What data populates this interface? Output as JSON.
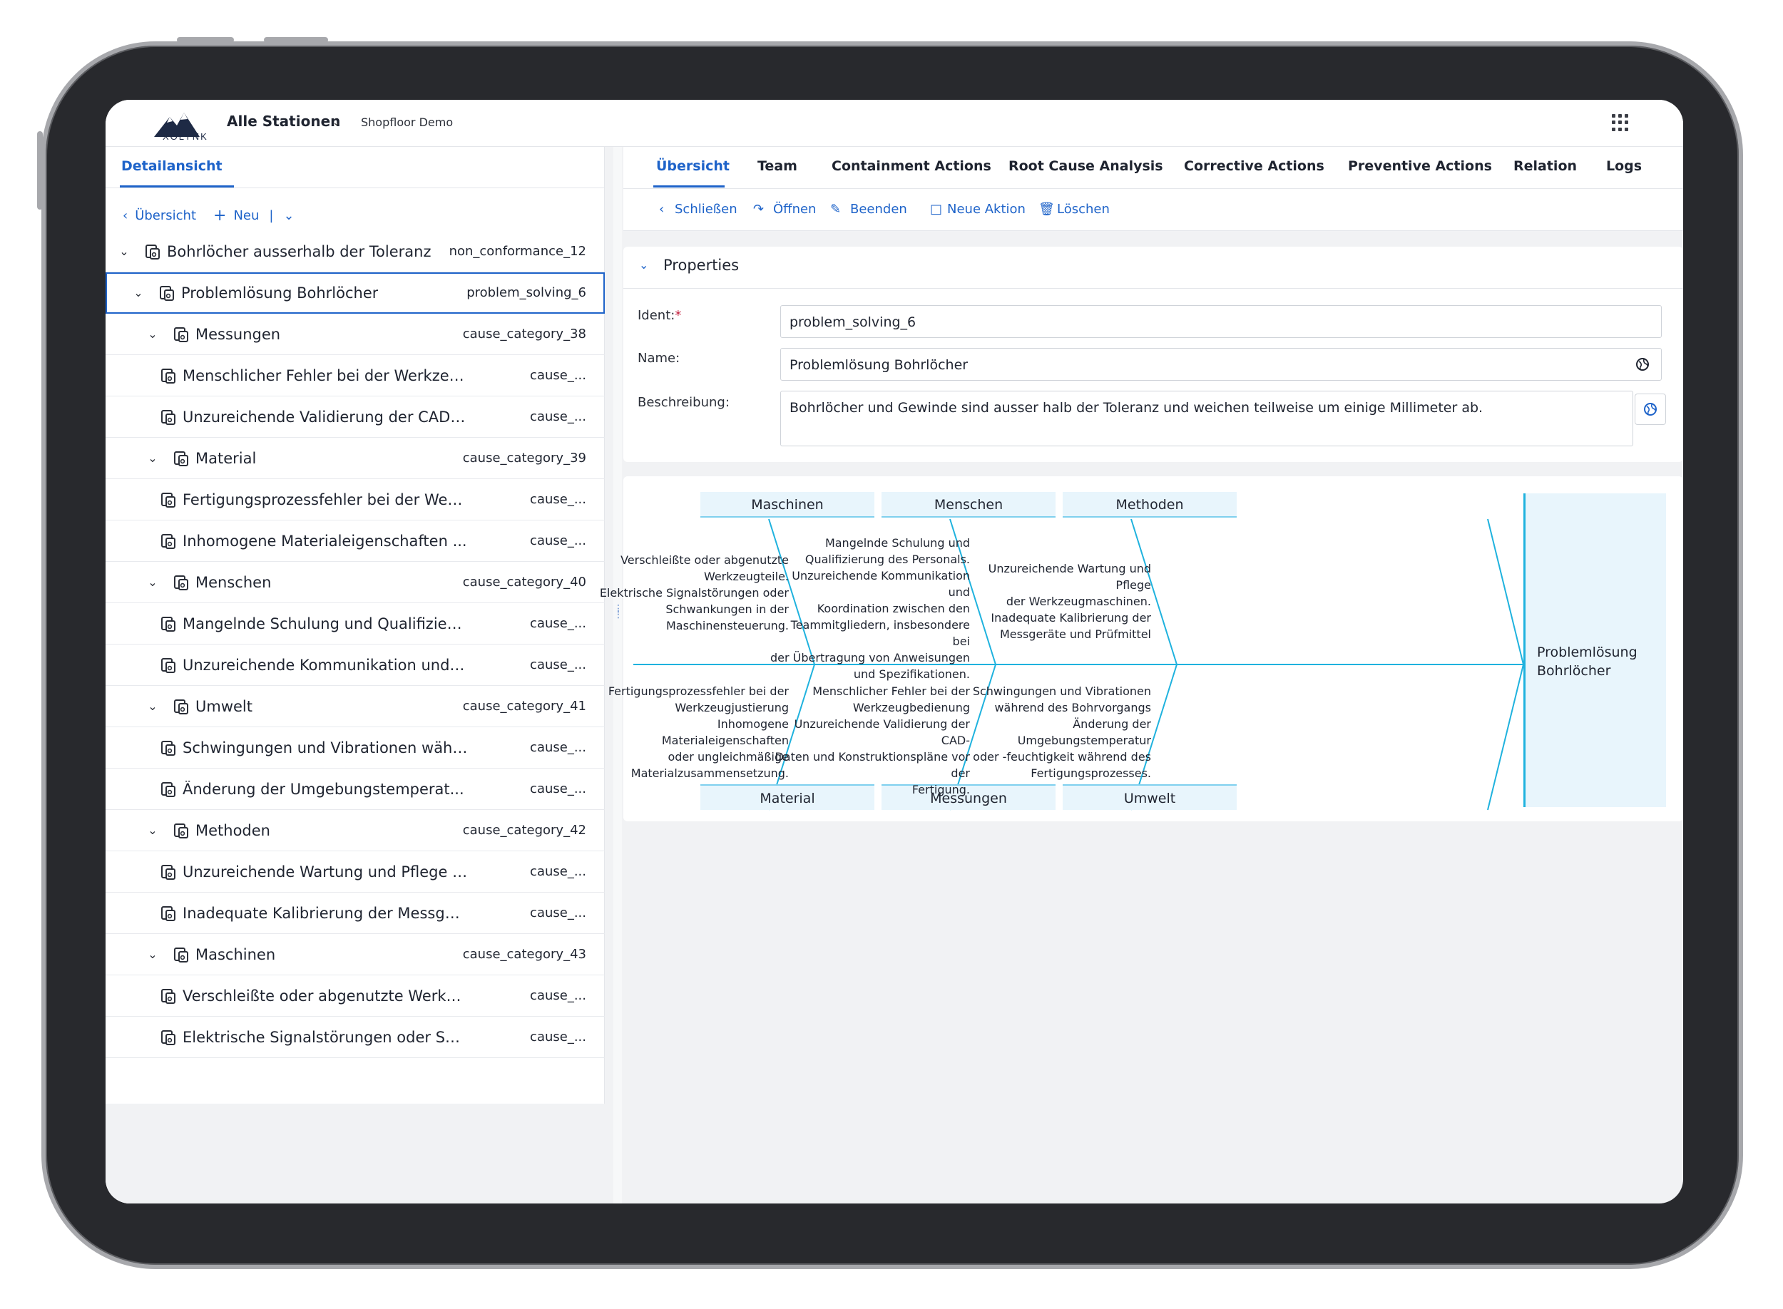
{
  "app": {
    "logo_text": "XOLYNK",
    "station": "Alle Stationen",
    "environment": "Shopfloor Demo"
  },
  "left_panel": {
    "tab": "Detailansicht",
    "actions": {
      "back": "Übersicht",
      "new": "Neu"
    },
    "tree": [
      {
        "level": 0,
        "expanded": true,
        "label": "Bohrlöcher ausserhalb der Toleranz",
        "id": "non_conformance_12"
      },
      {
        "level": 1,
        "expanded": true,
        "selected": true,
        "label": "Problemlösung Bohrlöcher",
        "id": "problem_solving_6"
      },
      {
        "level": 2,
        "expanded": true,
        "label": "Messungen",
        "id": "cause_category_38"
      },
      {
        "level": 3,
        "label": "Menschlicher Fehler bei der Werkzeu...",
        "id": "cause_..."
      },
      {
        "level": 3,
        "label": "Unzureichende Validierung der CAD-...",
        "id": "cause_..."
      },
      {
        "level": 2,
        "expanded": true,
        "label": "Material",
        "id": "cause_category_39"
      },
      {
        "level": 3,
        "label": "Fertigungsprozessfehler bei der Werk...",
        "id": "cause_..."
      },
      {
        "level": 3,
        "label": "Inhomogene Materialeigenschaften ...",
        "id": "cause_..."
      },
      {
        "level": 2,
        "expanded": true,
        "label": "Menschen",
        "id": "cause_category_40"
      },
      {
        "level": 3,
        "label": "Mangelnde Schulung und Qualifizieru...",
        "id": "cause_..."
      },
      {
        "level": 3,
        "label": "Unzureichende Kommunikation und ...",
        "id": "cause_..."
      },
      {
        "level": 2,
        "expanded": true,
        "label": "Umwelt",
        "id": "cause_category_41"
      },
      {
        "level": 3,
        "label": "Schwingungen und Vibrationen währ...",
        "id": "cause_..."
      },
      {
        "level": 3,
        "label": "Änderung der Umgebungstemperat...",
        "id": "cause_..."
      },
      {
        "level": 2,
        "expanded": true,
        "label": "Methoden",
        "id": "cause_category_42"
      },
      {
        "level": 3,
        "label": "Unzureichende Wartung und Pflege d...",
        "id": "cause_..."
      },
      {
        "level": 3,
        "label": "Inadequate Kalibrierung der Messger...",
        "id": "cause_..."
      },
      {
        "level": 2,
        "expanded": true,
        "label": "Maschinen",
        "id": "cause_category_43"
      },
      {
        "level": 3,
        "label": "Verschleißte oder abgenutzte Werkze...",
        "id": "cause_..."
      },
      {
        "level": 3,
        "label": "Elektrische Signalstörungen oder Sch...",
        "id": "cause_..."
      }
    ]
  },
  "tabs": [
    "Übersicht",
    "Team",
    "Containment Actions",
    "Root Cause Analysis",
    "Corrective Actions",
    "Preventive Actions",
    "Relation",
    "Logs"
  ],
  "actions": [
    "Schließen",
    "Öffnen",
    "Beenden",
    "Neue Aktion",
    "Löschen"
  ],
  "properties": {
    "title": "Properties",
    "ident_label": "Ident:",
    "ident_required": "*",
    "ident_value": "problem_solving_6",
    "name_label": "Name:",
    "name_value": "Problemlösung Bohrlöcher",
    "description_label": "Beschreibung:",
    "description_value": "Bohrlöcher und Gewinde sind ausser halb der Toleranz und weichen teilweise um einige Millimeter ab."
  },
  "fishbone": {
    "head": "Problemlösung Bohrlöcher",
    "top": [
      {
        "category": "Maschinen",
        "causes": [
          "Verschleißte oder abgenutzte",
          "Werkzeugteile.",
          "Elektrische Signalstörungen oder",
          "Schwankungen in der",
          "Maschinensteuerung."
        ]
      },
      {
        "category": "Menschen",
        "causes": [
          "Mangelnde Schulung und",
          "Qualifizierung des Personals.",
          "Unzureichende Kommunikation und",
          "Koordination zwischen den",
          "Teammitgliedern, insbesondere bei",
          "der Übertragung von Anweisungen",
          "und Spezifikationen."
        ]
      },
      {
        "category": "Methoden",
        "causes": [
          "Unzureichende Wartung und Pflege",
          "der Werkzeugmaschinen.",
          "Inadequate Kalibrierung der",
          "Messgeräte und Prüfmittel"
        ]
      }
    ],
    "bottom": [
      {
        "category": "Material",
        "causes": [
          "Fertigungsprozessfehler bei der",
          "Werkzeugjustierung",
          "Inhomogene Materialeigenschaften",
          "oder ungleichmäßige",
          "Materialzusammensetzung."
        ]
      },
      {
        "category": "Messungen",
        "causes": [
          "Menschlicher Fehler bei der",
          "Werkzeugbedienung",
          "Unzureichende Validierung der CAD-",
          "Daten und Konstruktionspläne vor der",
          "Fertigung."
        ]
      },
      {
        "category": "Umwelt",
        "causes": [
          "Schwingungen und Vibrationen",
          "während des Bohrvorgangs",
          "Änderung der Umgebungstemperatur",
          "oder -feuchtigkeit während des",
          "Fertigungsprozesses."
        ]
      }
    ]
  },
  "colors": {
    "accent": "#1e63c9",
    "fishbone_line": "#1fb2de",
    "category_fill": "#e8f5fc"
  }
}
